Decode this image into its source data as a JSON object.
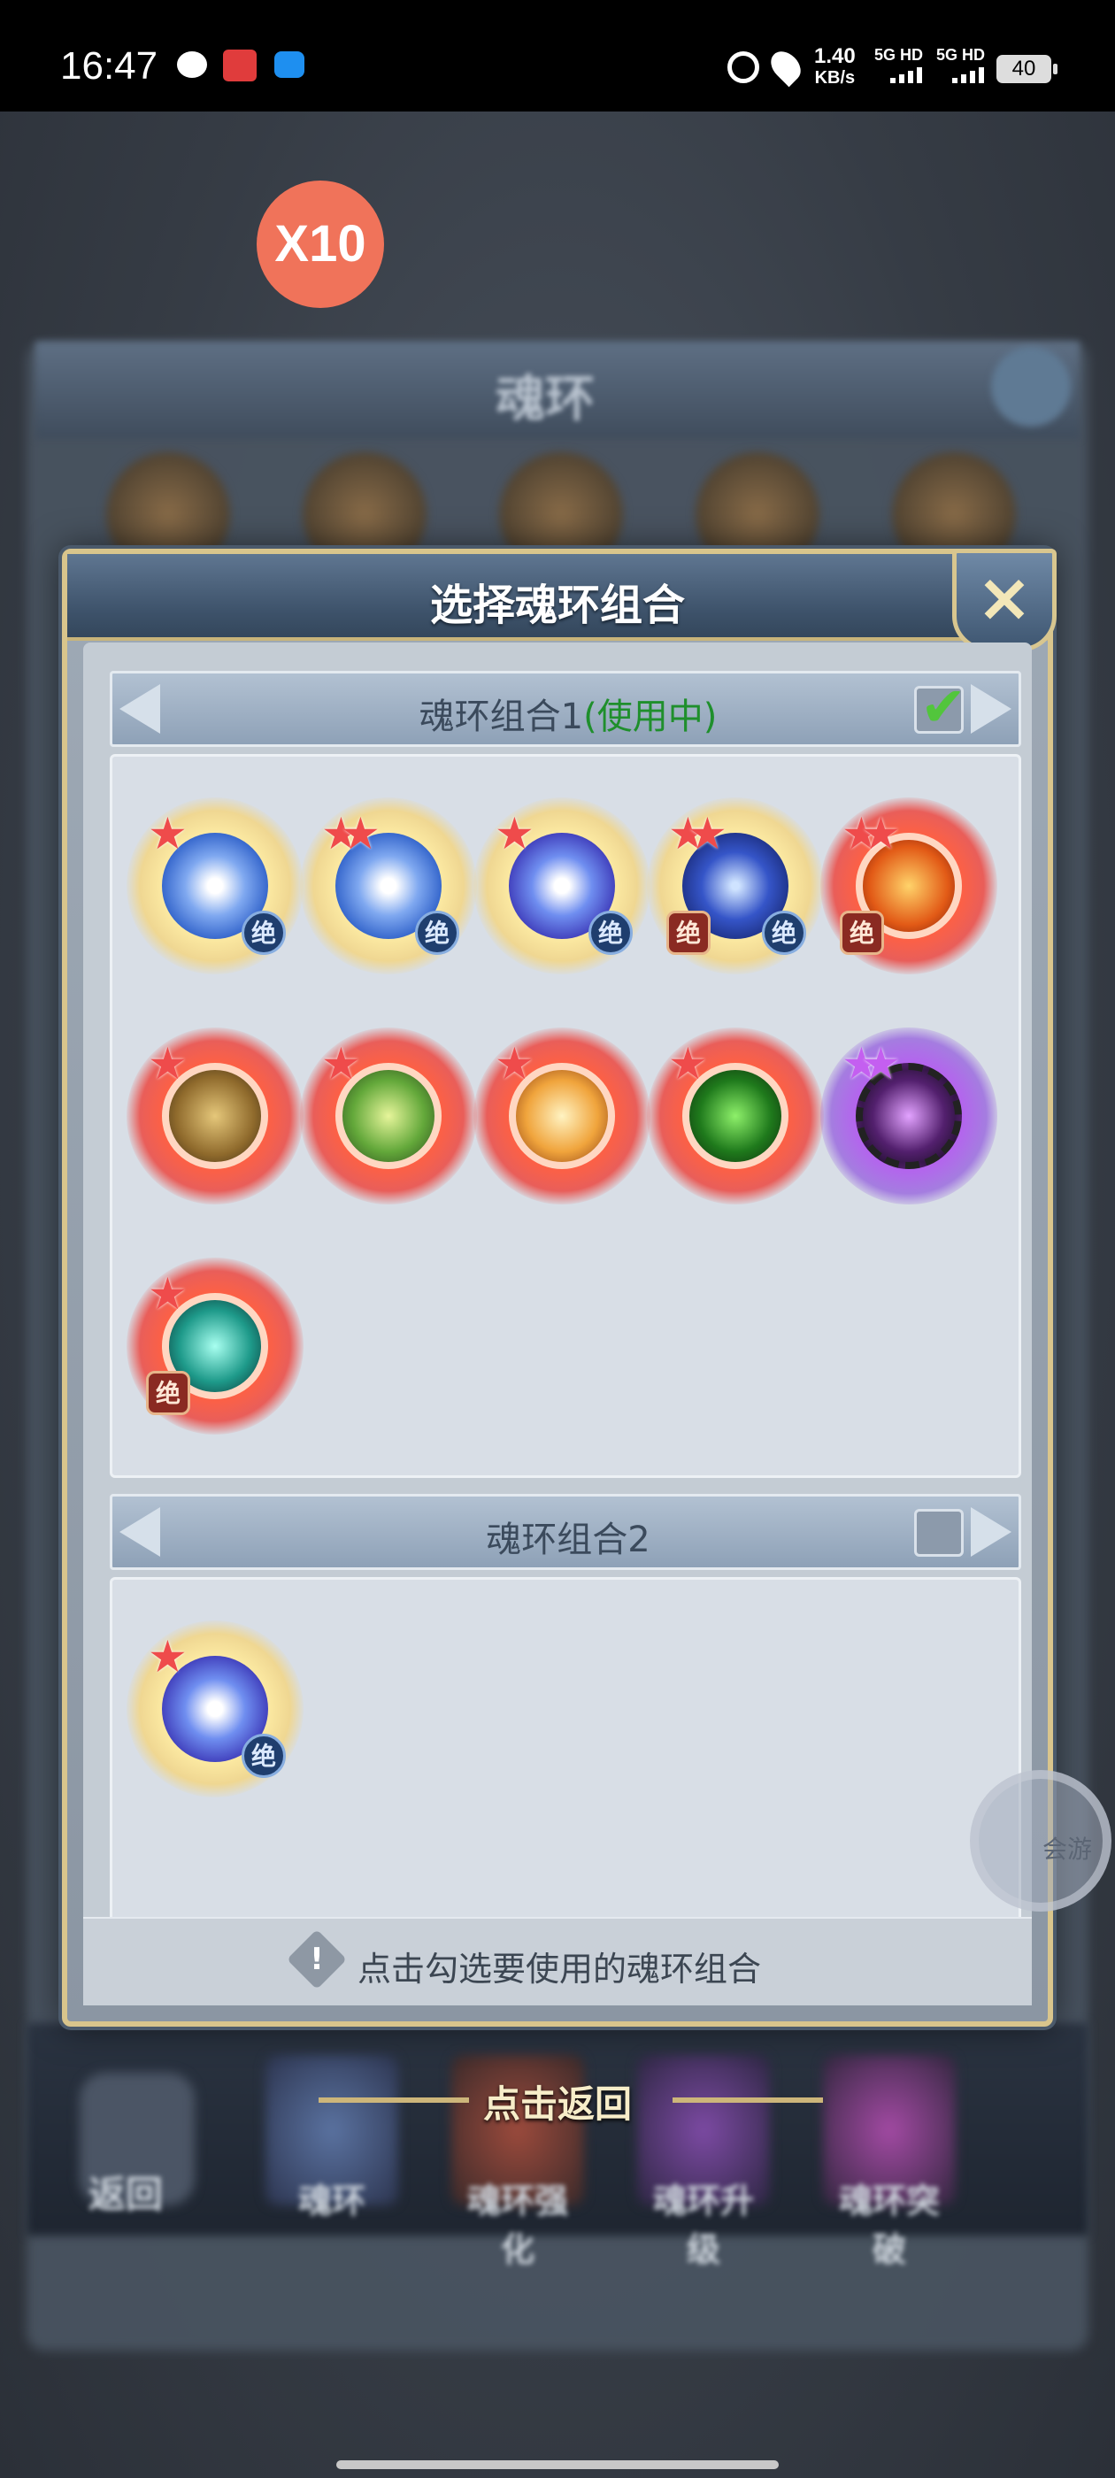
{
  "status_bar": {
    "time": "16:47",
    "speed_value": "1.40",
    "speed_unit": "KB/s",
    "net1": "5G HD",
    "net2": "5G HD",
    "battery": "40"
  },
  "overlay_badge": "X10",
  "background": {
    "title": "魂环",
    "back_label": "返回",
    "tabs": [
      "魂环",
      "魂环强化",
      "魂环升级",
      "魂环突破"
    ]
  },
  "dialog": {
    "title": "选择魂环组合",
    "close_icon": "close-icon",
    "groups": [
      {
        "name": "魂环组合1",
        "status": "(使用中)",
        "checked": true,
        "rings": [
          {
            "type": "blue-swirl",
            "stars": 1,
            "badge": "绝",
            "badge_style": "blue",
            "frame": "gold"
          },
          {
            "type": "blue-dragon",
            "stars": 2,
            "badge": "绝",
            "badge_style": "blue",
            "frame": "gold"
          },
          {
            "type": "purple-swirl",
            "stars": 1,
            "badge": "绝",
            "badge_style": "blue",
            "frame": "gold"
          },
          {
            "type": "blue-beast",
            "stars": 2,
            "badge": "绝",
            "badge_style": "both",
            "frame": "gold"
          },
          {
            "type": "fire-demon",
            "stars": 2,
            "badge": "绝",
            "badge_style": "red",
            "frame": "red"
          },
          {
            "type": "bronze-helm",
            "stars": 1,
            "badge": "",
            "frame": "red"
          },
          {
            "type": "green-phoenix",
            "stars": 1,
            "badge": "",
            "frame": "red"
          },
          {
            "type": "flame-phoenix",
            "stars": 1,
            "badge": "",
            "frame": "red"
          },
          {
            "type": "clover",
            "stars": 1,
            "badge": "",
            "frame": "red"
          },
          {
            "type": "dark-dragon",
            "stars": 2,
            "badge": "",
            "frame": "purple"
          },
          {
            "type": "teal-wings",
            "stars": 1,
            "badge": "绝",
            "badge_style": "red",
            "frame": "red"
          }
        ]
      },
      {
        "name": "魂环组合2",
        "status": "",
        "checked": false,
        "rings": [
          {
            "type": "purple-swirl",
            "stars": 1,
            "badge": "绝",
            "badge_style": "blue",
            "frame": "gold"
          }
        ]
      }
    ],
    "hint": "点击勾选要使用的魂环组合",
    "return_label": "点击返回"
  },
  "watermark": "会游"
}
